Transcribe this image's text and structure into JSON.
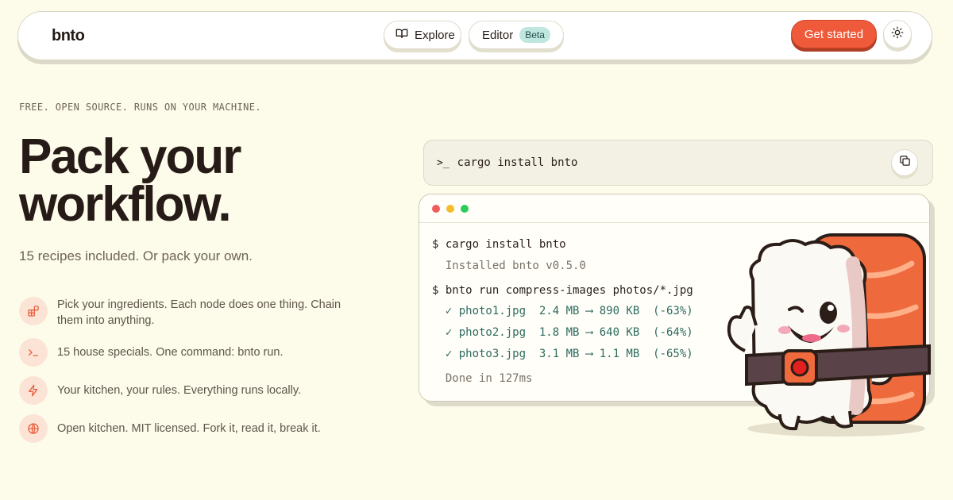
{
  "nav": {
    "logo": "bnto",
    "explore_label": "Explore",
    "editor_label": "Editor",
    "editor_badge": "Beta",
    "get_started_label": "Get started",
    "theme_icon": "sun-icon"
  },
  "hero": {
    "eyebrow": "FREE. OPEN SOURCE. RUNS ON YOUR MACHINE.",
    "title_line1": "Pack your",
    "title_line2": "workflow.",
    "tagline": "15 recipes included. Or pack your own."
  },
  "features": [
    {
      "icon": "blocks-icon",
      "text": "Pick your ingredients. Each node does one thing. Chain them into anything."
    },
    {
      "icon": "terminal-prompt-icon",
      "text": "15 house specials. One command: bnto run."
    },
    {
      "icon": "lightning-icon",
      "text": "Your kitchen, your rules. Everything runs locally."
    },
    {
      "icon": "globe-icon",
      "text": "Open kitchen. MIT licensed. Fork it, read it, break it."
    }
  ],
  "install": {
    "prompt": ">_",
    "command": "cargo install bnto",
    "copy_icon": "copy-icon"
  },
  "terminal": {
    "lines": [
      "$ cargo install bnto",
      "  Installed bnto v0.5.0",
      "$ bnto run compress-images photos/*.jpg",
      "  ✓ photo1.jpg  2.4 MB ⟶ 890 KB  (-63%)",
      "  ✓ photo2.jpg  1.8 MB ⟶ 640 KB  (-64%)",
      "  ✓ photo3.jpg  3.1 MB ⟶ 1.1 MB  (-65%)",
      "  Done in 127ms"
    ]
  },
  "colors": {
    "background": "#fdfbea",
    "accent": "#ef5a3b",
    "badge_bg": "#bfe6df",
    "success": "#2e6b5f",
    "icon_bg": "#fbe4d6"
  }
}
